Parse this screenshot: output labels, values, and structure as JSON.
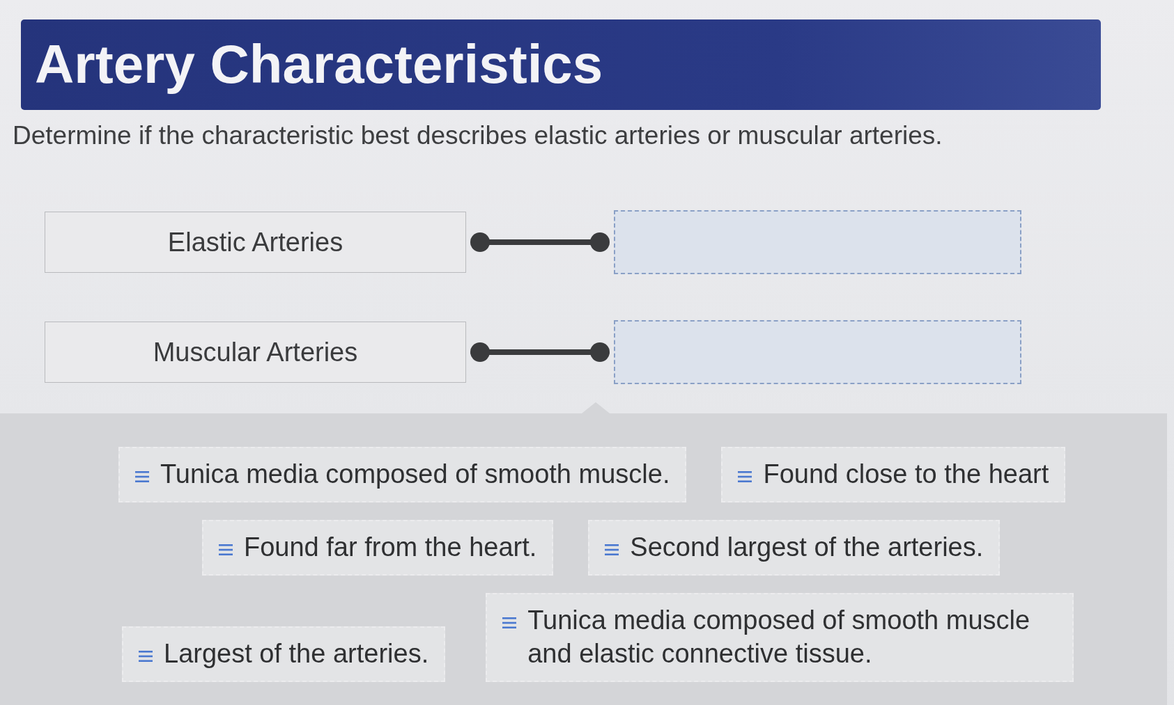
{
  "title": "Artery Characteristics",
  "instructions": "Determine if the characteristic best describes elastic arteries or muscular arteries.",
  "categories": [
    {
      "label": "Elastic Arteries"
    },
    {
      "label": "Muscular Arteries"
    }
  ],
  "answer_rows": [
    {
      "options": [
        "Tunica media composed of smooth muscle.",
        "Found close to the heart"
      ]
    },
    {
      "options": [
        "Found far from the heart.",
        "Second largest of the arteries."
      ]
    },
    {
      "options": [
        "Largest of the arteries.",
        "Tunica media composed of smooth muscle and elastic connective tissue."
      ]
    }
  ]
}
